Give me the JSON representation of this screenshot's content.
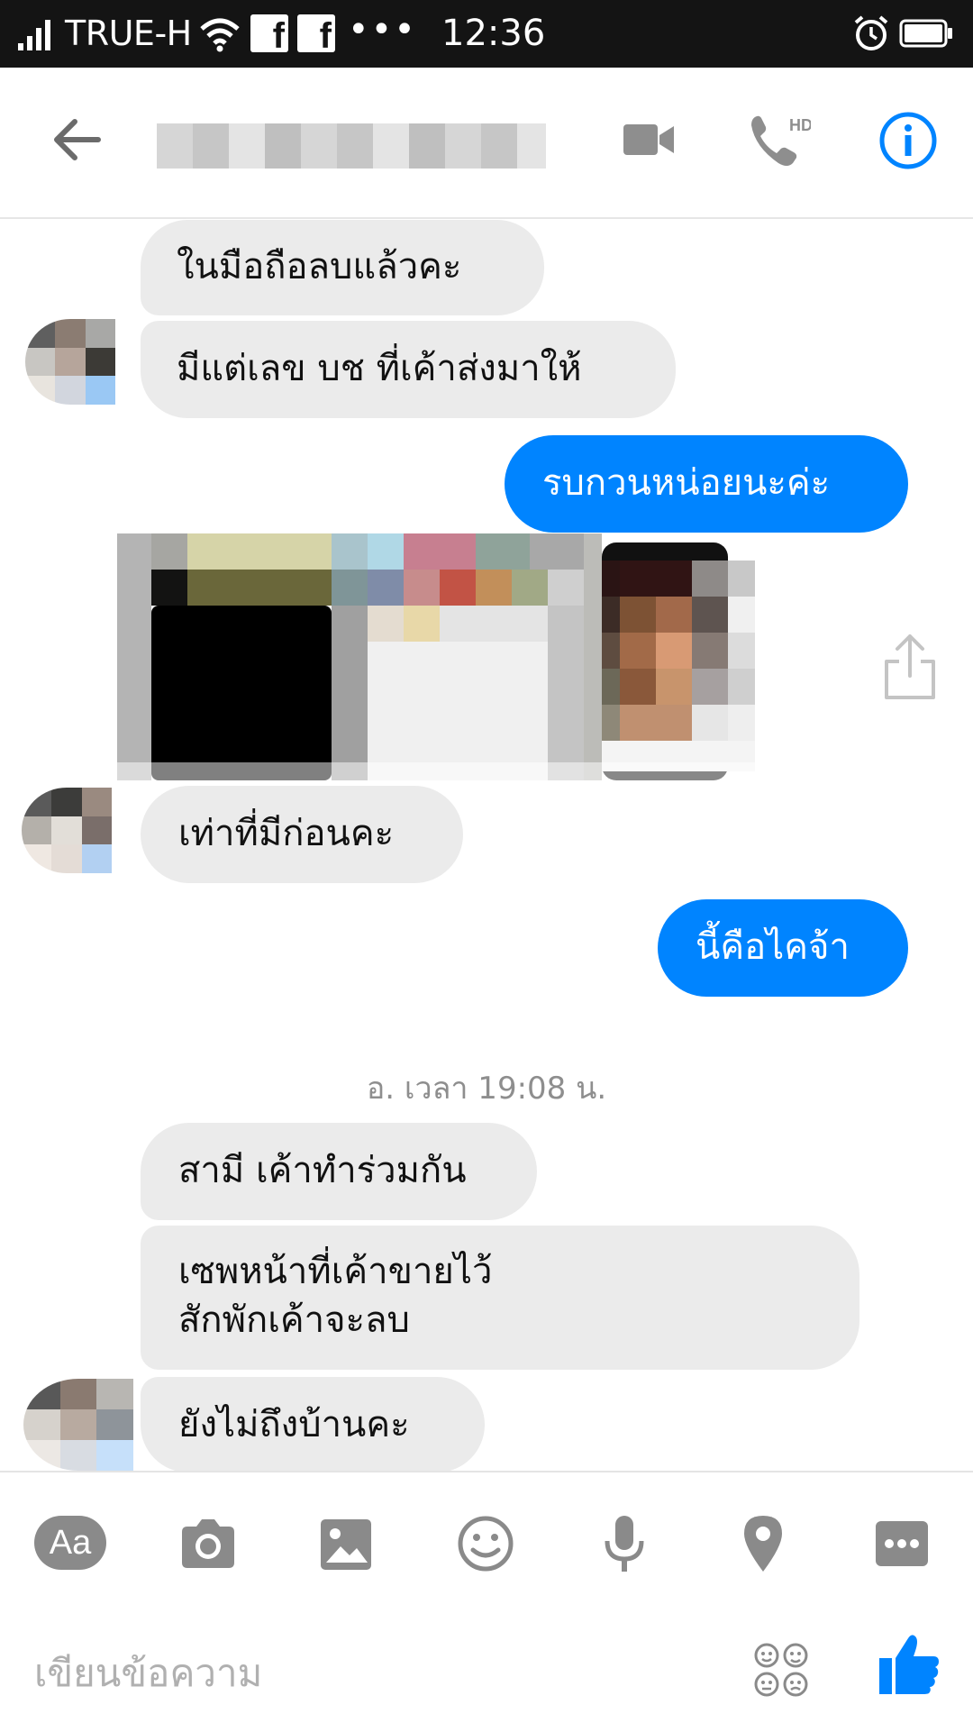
{
  "status_bar": {
    "carrier": "TRUE-H",
    "time": "12:36",
    "more": "•••",
    "fb_icon_1": "f",
    "fb_icon_2": "f",
    "icons": [
      "signal-icon",
      "wifi-icon",
      "facebook-icon",
      "facebook-icon",
      "alarm-icon",
      "battery-icon"
    ]
  },
  "header": {
    "contact_name": "",
    "icons": [
      "back-arrow-icon",
      "video-call-icon",
      "phone-hd-icon",
      "info-icon"
    ],
    "phone_badge": "HD",
    "accent_color": "#0084ff"
  },
  "messages": [
    {
      "side": "incoming",
      "text": "ในมือถือลบแล้วคะ"
    },
    {
      "side": "incoming",
      "text": "มีแต่เลข บช ที่เค้าส่งมาให้"
    },
    {
      "side": "outgoing",
      "text": "รบกวนหน่อยนะค่ะ"
    },
    {
      "side": "incoming",
      "type": "image"
    },
    {
      "side": "incoming",
      "text": "เท่าที่มีก่อนคะ"
    },
    {
      "side": "outgoing",
      "text": "นี้คือไคจ้า"
    },
    {
      "side": "incoming",
      "text": "สามี เค้าทำร่วมกัน"
    },
    {
      "side": "incoming",
      "text": "เซพหน้าที่เค้าขายไว้\nสักพักเค้าจะลบ"
    },
    {
      "side": "incoming",
      "text": "ยังไม่ถึงบ้านคะ"
    }
  ],
  "timestamp": "อ. เวลา 19:08 น.",
  "composer": {
    "aa_label": "Aa",
    "placeholder": "เขียนข้อความ",
    "tools": [
      "text-format-icon",
      "camera-icon",
      "gallery-icon",
      "emoji-icon",
      "microphone-icon",
      "location-icon",
      "more-icon"
    ],
    "send_icon": "thumbs-up-icon"
  },
  "colors": {
    "outgoing_bubble": "#0084ff",
    "incoming_bubble": "#ebebeb",
    "status_bar": "#141414",
    "icon_gray": "#8a8a8a"
  }
}
